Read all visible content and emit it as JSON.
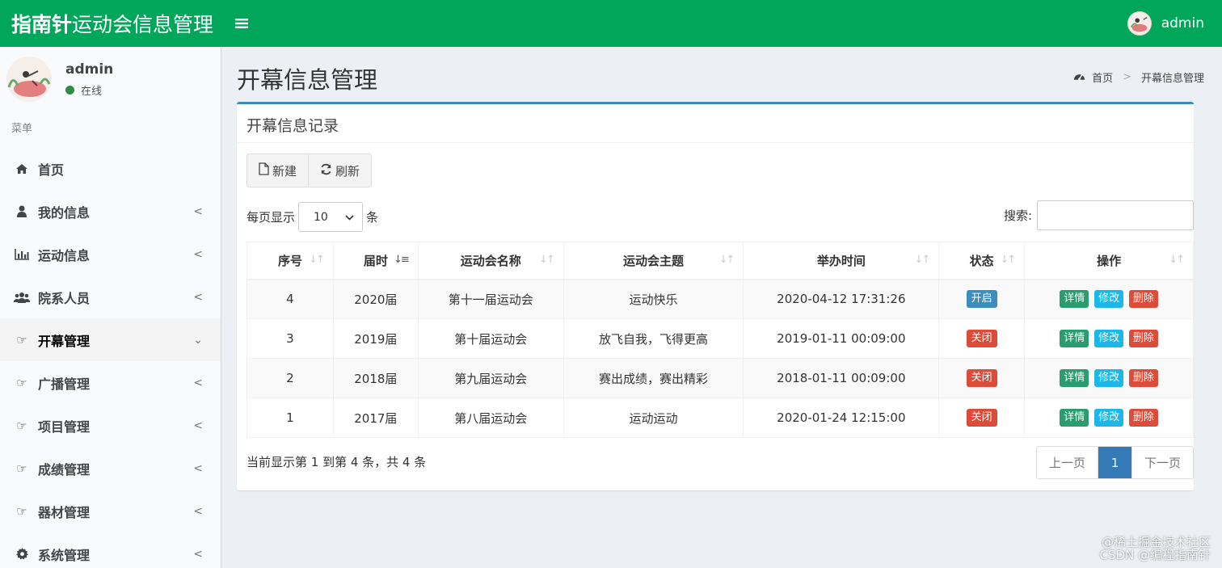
{
  "header": {
    "brand_bold": "指南针",
    "brand_rest": "运动会信息管理",
    "menu_toggle_icon": "bars-icon",
    "username": "admin"
  },
  "sidebar": {
    "user_name": "admin",
    "user_status": "在线",
    "menu_header": "菜单",
    "items": [
      {
        "label": "首页",
        "icon": "home-icon",
        "chevron": ""
      },
      {
        "label": "我的信息",
        "icon": "user-icon",
        "chevron": "<"
      },
      {
        "label": "运动信息",
        "icon": "bar-chart-icon",
        "chevron": "<"
      },
      {
        "label": "院系人员",
        "icon": "users-icon",
        "chevron": "<"
      },
      {
        "label": "开幕管理",
        "icon": "hand-pointer-icon",
        "chevron": "⌄"
      },
      {
        "label": "广播管理",
        "icon": "hand-pointer-icon",
        "chevron": "<"
      },
      {
        "label": "项目管理",
        "icon": "hand-pointer-icon",
        "chevron": "<"
      },
      {
        "label": "成绩管理",
        "icon": "hand-pointer-icon",
        "chevron": "<"
      },
      {
        "label": "器材管理",
        "icon": "hand-pointer-icon",
        "chevron": "<"
      },
      {
        "label": "系统管理",
        "icon": "gear-icon",
        "chevron": "<"
      }
    ]
  },
  "page": {
    "title": "开幕信息管理",
    "breadcrumb": [
      "首页",
      "开幕信息管理"
    ]
  },
  "box": {
    "title": "开幕信息记录",
    "new_label": "新建",
    "refresh_label": "刷新",
    "length_prefix": "每页显示",
    "length_value": "10",
    "length_suffix": "条",
    "search_label": "搜索:",
    "search_value": ""
  },
  "table": {
    "columns": [
      "序号",
      "届时",
      "运动会名称",
      "运动会主题",
      "举办时间",
      "状态",
      "操作"
    ],
    "rows": [
      {
        "id": "4",
        "session": "2020届",
        "name": "第十一届运动会",
        "theme": "运动快乐",
        "time": "2020-04-12 17:31:26",
        "status": "开启"
      },
      {
        "id": "3",
        "session": "2019届",
        "name": "第十届运动会",
        "theme": "放飞自我，飞得更高",
        "time": "2019-01-11 00:09:00",
        "status": "关闭"
      },
      {
        "id": "2",
        "session": "2018届",
        "name": "第九届运动会",
        "theme": "赛出成绩，赛出精彩",
        "time": "2018-01-11 00:09:00",
        "status": "关闭"
      },
      {
        "id": "1",
        "session": "2017届",
        "name": "第八届运动会",
        "theme": "运动运动",
        "time": "2020-01-24 12:15:00",
        "status": "关闭"
      }
    ],
    "actions": {
      "detail": "详情",
      "edit": "修改",
      "delete": "删除"
    },
    "info": "当前显示第 1 到第 4 条，共 4 条"
  },
  "pager": {
    "prev": "上一页",
    "current": "1",
    "next": "下一页"
  },
  "watermark": {
    "line1": "@稀土掘金技术社区",
    "line2": "CSDN @编程指南针"
  },
  "colors": {
    "header_green": "#00a65a",
    "box_accent": "#3c8dbc",
    "status_on": "#3c8dbc",
    "status_off": "#dd4b39"
  }
}
